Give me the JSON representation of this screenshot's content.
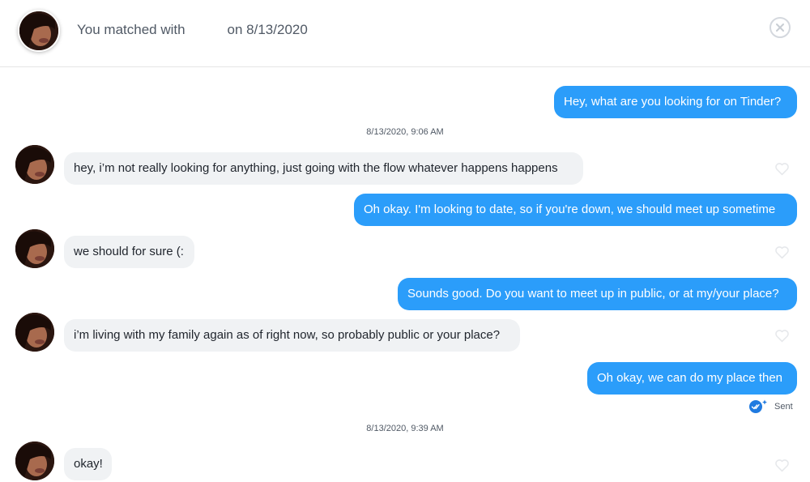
{
  "header": {
    "matched_prefix": "You matched with",
    "matched_suffix": "on 8/13/2020"
  },
  "colors": {
    "outgoing_bubble": "#2b9dfa",
    "incoming_bubble": "#f0f2f4",
    "accent_blue": "#1f7ae0"
  },
  "timestamps": [
    "8/13/2020, 9:06 AM",
    "8/13/2020, 9:39 AM"
  ],
  "messages": [
    {
      "direction": "out",
      "text": "Hey, what are you looking for on Tinder?"
    },
    {
      "direction": "in",
      "text": "hey, i’m not really looking for anything, just going with the flow whatever happens happens"
    },
    {
      "direction": "out",
      "text": "Oh okay. I'm looking to date, so if you're down, we should meet up sometime"
    },
    {
      "direction": "in",
      "text": "we should for sure (:"
    },
    {
      "direction": "out",
      "text": "Sounds good. Do you want to meet up in public, or at my/your place?"
    },
    {
      "direction": "in",
      "text": "i’m living with my family again as of right now, so probably public or your place?"
    },
    {
      "direction": "out",
      "text": "Oh okay, we can do my place then"
    },
    {
      "direction": "in",
      "text": "okay!"
    }
  ],
  "status": {
    "sent_label": "Sent",
    "sent_icon": "read-receipt-icon"
  },
  "icons": {
    "close": "close-icon",
    "like": "heart-icon"
  }
}
